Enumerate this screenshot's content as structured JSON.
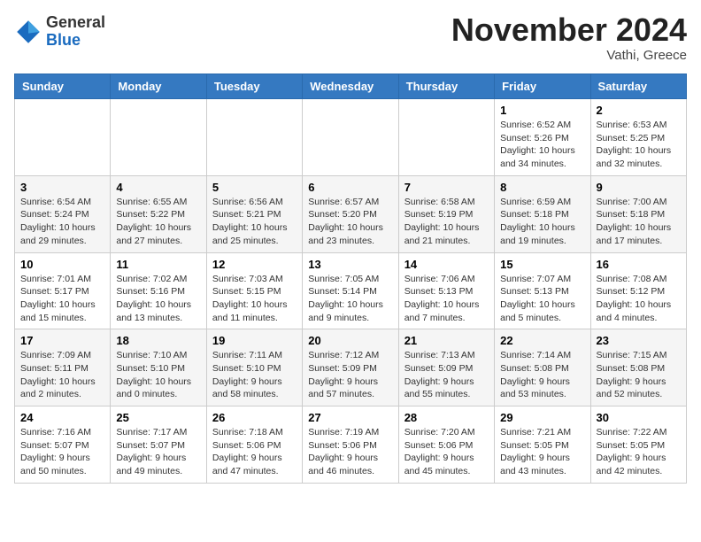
{
  "logo": {
    "general": "General",
    "blue": "Blue"
  },
  "title": "November 2024",
  "location": "Vathi, Greece",
  "days_header": [
    "Sunday",
    "Monday",
    "Tuesday",
    "Wednesday",
    "Thursday",
    "Friday",
    "Saturday"
  ],
  "weeks": [
    [
      {
        "day": "",
        "info": ""
      },
      {
        "day": "",
        "info": ""
      },
      {
        "day": "",
        "info": ""
      },
      {
        "day": "",
        "info": ""
      },
      {
        "day": "",
        "info": ""
      },
      {
        "day": "1",
        "info": "Sunrise: 6:52 AM\nSunset: 5:26 PM\nDaylight: 10 hours and 34 minutes."
      },
      {
        "day": "2",
        "info": "Sunrise: 6:53 AM\nSunset: 5:25 PM\nDaylight: 10 hours and 32 minutes."
      }
    ],
    [
      {
        "day": "3",
        "info": "Sunrise: 6:54 AM\nSunset: 5:24 PM\nDaylight: 10 hours and 29 minutes."
      },
      {
        "day": "4",
        "info": "Sunrise: 6:55 AM\nSunset: 5:22 PM\nDaylight: 10 hours and 27 minutes."
      },
      {
        "day": "5",
        "info": "Sunrise: 6:56 AM\nSunset: 5:21 PM\nDaylight: 10 hours and 25 minutes."
      },
      {
        "day": "6",
        "info": "Sunrise: 6:57 AM\nSunset: 5:20 PM\nDaylight: 10 hours and 23 minutes."
      },
      {
        "day": "7",
        "info": "Sunrise: 6:58 AM\nSunset: 5:19 PM\nDaylight: 10 hours and 21 minutes."
      },
      {
        "day": "8",
        "info": "Sunrise: 6:59 AM\nSunset: 5:18 PM\nDaylight: 10 hours and 19 minutes."
      },
      {
        "day": "9",
        "info": "Sunrise: 7:00 AM\nSunset: 5:18 PM\nDaylight: 10 hours and 17 minutes."
      }
    ],
    [
      {
        "day": "10",
        "info": "Sunrise: 7:01 AM\nSunset: 5:17 PM\nDaylight: 10 hours and 15 minutes."
      },
      {
        "day": "11",
        "info": "Sunrise: 7:02 AM\nSunset: 5:16 PM\nDaylight: 10 hours and 13 minutes."
      },
      {
        "day": "12",
        "info": "Sunrise: 7:03 AM\nSunset: 5:15 PM\nDaylight: 10 hours and 11 minutes."
      },
      {
        "day": "13",
        "info": "Sunrise: 7:05 AM\nSunset: 5:14 PM\nDaylight: 10 hours and 9 minutes."
      },
      {
        "day": "14",
        "info": "Sunrise: 7:06 AM\nSunset: 5:13 PM\nDaylight: 10 hours and 7 minutes."
      },
      {
        "day": "15",
        "info": "Sunrise: 7:07 AM\nSunset: 5:13 PM\nDaylight: 10 hours and 5 minutes."
      },
      {
        "day": "16",
        "info": "Sunrise: 7:08 AM\nSunset: 5:12 PM\nDaylight: 10 hours and 4 minutes."
      }
    ],
    [
      {
        "day": "17",
        "info": "Sunrise: 7:09 AM\nSunset: 5:11 PM\nDaylight: 10 hours and 2 minutes."
      },
      {
        "day": "18",
        "info": "Sunrise: 7:10 AM\nSunset: 5:10 PM\nDaylight: 10 hours and 0 minutes."
      },
      {
        "day": "19",
        "info": "Sunrise: 7:11 AM\nSunset: 5:10 PM\nDaylight: 9 hours and 58 minutes."
      },
      {
        "day": "20",
        "info": "Sunrise: 7:12 AM\nSunset: 5:09 PM\nDaylight: 9 hours and 57 minutes."
      },
      {
        "day": "21",
        "info": "Sunrise: 7:13 AM\nSunset: 5:09 PM\nDaylight: 9 hours and 55 minutes."
      },
      {
        "day": "22",
        "info": "Sunrise: 7:14 AM\nSunset: 5:08 PM\nDaylight: 9 hours and 53 minutes."
      },
      {
        "day": "23",
        "info": "Sunrise: 7:15 AM\nSunset: 5:08 PM\nDaylight: 9 hours and 52 minutes."
      }
    ],
    [
      {
        "day": "24",
        "info": "Sunrise: 7:16 AM\nSunset: 5:07 PM\nDaylight: 9 hours and 50 minutes."
      },
      {
        "day": "25",
        "info": "Sunrise: 7:17 AM\nSunset: 5:07 PM\nDaylight: 9 hours and 49 minutes."
      },
      {
        "day": "26",
        "info": "Sunrise: 7:18 AM\nSunset: 5:06 PM\nDaylight: 9 hours and 47 minutes."
      },
      {
        "day": "27",
        "info": "Sunrise: 7:19 AM\nSunset: 5:06 PM\nDaylight: 9 hours and 46 minutes."
      },
      {
        "day": "28",
        "info": "Sunrise: 7:20 AM\nSunset: 5:06 PM\nDaylight: 9 hours and 45 minutes."
      },
      {
        "day": "29",
        "info": "Sunrise: 7:21 AM\nSunset: 5:05 PM\nDaylight: 9 hours and 43 minutes."
      },
      {
        "day": "30",
        "info": "Sunrise: 7:22 AM\nSunset: 5:05 PM\nDaylight: 9 hours and 42 minutes."
      }
    ]
  ]
}
